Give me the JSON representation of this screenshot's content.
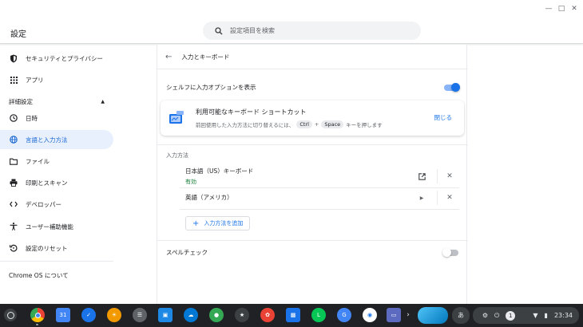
{
  "header": {
    "title": "設定",
    "search_placeholder": "設定項目を検索"
  },
  "window_controls": [
    "minimize-icon",
    "maximize-icon",
    "close-icon"
  ],
  "sidebar": {
    "items": [
      {
        "label": "セキュリティとプライバシー",
        "icon": "shield-icon"
      },
      {
        "label": "アプリ",
        "icon": "apps-grid-icon"
      }
    ],
    "advanced_label": "詳細設定",
    "advanced_items": [
      {
        "label": "日時",
        "icon": "clock-icon"
      },
      {
        "label": "言語と入力方法",
        "icon": "globe-icon",
        "active": true
      },
      {
        "label": "ファイル",
        "icon": "folder-icon"
      },
      {
        "label": "印刷とスキャン",
        "icon": "printer-icon"
      },
      {
        "label": "デベロッパー",
        "icon": "code-icon"
      },
      {
        "label": "ユーザー補助機能",
        "icon": "accessibility-icon"
      },
      {
        "label": "設定のリセット",
        "icon": "reset-icon"
      }
    ],
    "about_label": "Chrome OS について"
  },
  "main": {
    "page_title": "入力とキーボード",
    "shelf_option_label": "シェルフに入力オプションを表示",
    "shelf_option_on": true,
    "banner": {
      "title": "利用可能なキーボード ショートカット",
      "desc_prefix": "前回使用した入力方法に切り替えるには、",
      "key1": "Ctrl",
      "plus": "+",
      "key2": "Space",
      "desc_suffix": "キーを押します",
      "close_label": "閉じる"
    },
    "input_methods_title": "入力方法",
    "methods": [
      {
        "name": "日本語（US）キーボード",
        "status": "有効"
      },
      {
        "name": "英語（アメリカ）",
        "status": ""
      }
    ],
    "add_method_label": "入力方法を追加",
    "spell_check_label": "スペルチェック",
    "spell_check_on": false
  },
  "shelf": {
    "time": "23:34",
    "notification_count": "1",
    "ime_indicator": "あ",
    "colors": {
      "bg": "#202124",
      "accent": "#1a73e8"
    }
  }
}
